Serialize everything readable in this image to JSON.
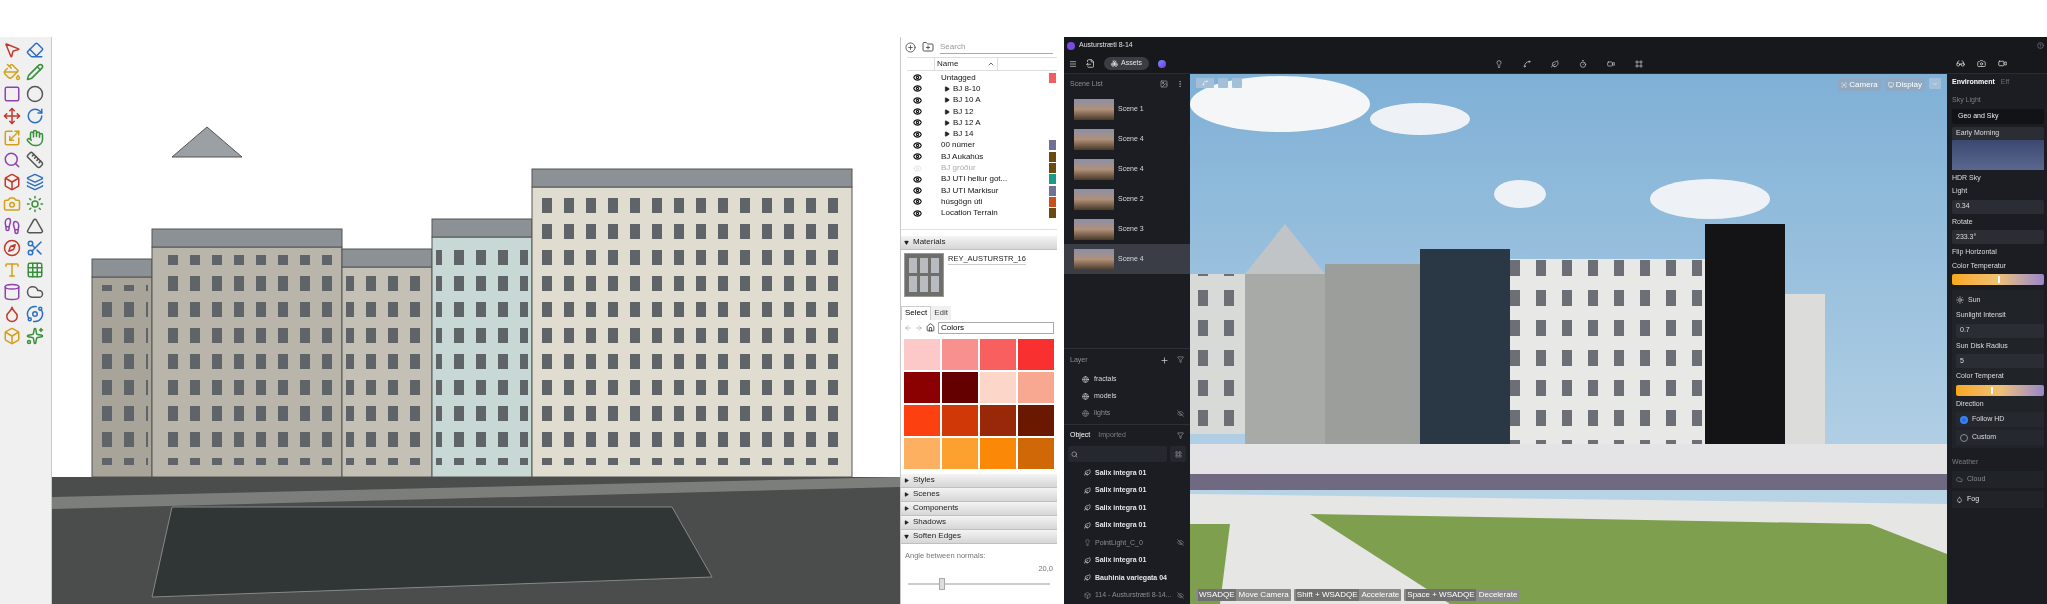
{
  "sketchup": {
    "tags_panel": {
      "search": {
        "placeholder": "Search"
      },
      "column_header": "Name",
      "tags": [
        {
          "name": "Untagged",
          "kind": "tag",
          "visible": true,
          "color": "#f06060"
        },
        {
          "name": "BJ 8-10",
          "kind": "folder",
          "visible": true,
          "expanded": false
        },
        {
          "name": "BJ 10 A",
          "kind": "folder",
          "visible": true,
          "expanded": false
        },
        {
          "name": "BJ 12",
          "kind": "folder",
          "visible": true,
          "expanded": false
        },
        {
          "name": "BJ 12 A",
          "kind": "folder",
          "visible": true,
          "expanded": false
        },
        {
          "name": "BJ 14",
          "kind": "folder",
          "visible": true,
          "expanded": false
        },
        {
          "name": "00 númer",
          "kind": "tag",
          "visible": true,
          "color": "#707094"
        },
        {
          "name": "BJ Aukahús",
          "kind": "tag",
          "visible": true,
          "color": "#6b4a10"
        },
        {
          "name": "BJ gróður",
          "kind": "tag",
          "visible": false,
          "color": "#6b4a10"
        },
        {
          "name": "BJ UTI  hellur got...",
          "kind": "tag",
          "visible": true,
          "color": "#1a9a8a"
        },
        {
          "name": "BJ UTI Markisur",
          "kind": "tag",
          "visible": true,
          "color": "#707094"
        },
        {
          "name": "húsgögn úti",
          "kind": "tag",
          "visible": true,
          "color": "#c8501a"
        },
        {
          "name": "Location Terrain",
          "kind": "tag",
          "visible": true,
          "color": "#6b4a10"
        }
      ]
    },
    "materials": {
      "title": "Materials",
      "expanded": true,
      "material_name": "REY_AUSTURSTR_16",
      "tabs": [
        {
          "label": "Select",
          "selected": true
        },
        {
          "label": "Edit",
          "selected": false
        }
      ],
      "library": "Colors",
      "swatches": [
        {
          "color": "#fcc8c8"
        },
        {
          "color": "#f99090"
        },
        {
          "color": "#f86060"
        },
        {
          "color": "#f83030"
        },
        {
          "color": "#8b0000"
        },
        {
          "color": "#640000"
        },
        {
          "color": "#fcd6c8"
        },
        {
          "color": "#f8a890"
        },
        {
          "color": "#fc4010"
        },
        {
          "color": "#d03808"
        },
        {
          "color": "#982808"
        },
        {
          "color": "#6a1800"
        },
        {
          "color": "#fcb060"
        },
        {
          "color": "#fca030"
        },
        {
          "color": "#fc8808"
        },
        {
          "color": "#d06808"
        }
      ]
    },
    "sections": [
      {
        "title": "Styles",
        "expanded": false
      },
      {
        "title": "Scenes",
        "expanded": false
      },
      {
        "title": "Components",
        "expanded": false
      },
      {
        "title": "Shadows",
        "expanded": false
      },
      {
        "title": "Soften Edges",
        "expanded": true
      }
    ],
    "soften_edges": {
      "label": "Angle between normals:",
      "value": "20,0",
      "level": 0.25
    }
  },
  "app": {
    "title": "Austurstræti 8-14",
    "assets_button": "Assets",
    "scene_list": {
      "title": "Scene List",
      "scenes": [
        {
          "name": "Scene 1",
          "selected": false
        },
        {
          "name": "Scene 4",
          "selected": false
        },
        {
          "name": "Scene 4",
          "selected": false
        },
        {
          "name": "Scene 2",
          "selected": false
        },
        {
          "name": "Scene 3",
          "selected": false
        },
        {
          "name": "Scene 4",
          "selected": true
        }
      ]
    },
    "layers": {
      "title": "Layer",
      "items": [
        {
          "name": "fractals",
          "visible": true
        },
        {
          "name": "models",
          "visible": true
        },
        {
          "name": "lights",
          "visible": false
        }
      ]
    },
    "object_tabs": [
      {
        "label": "Object",
        "selected": true
      },
      {
        "label": "Imported",
        "selected": false
      }
    ],
    "objects": [
      {
        "name": "Salix integra 01",
        "kind": "plant",
        "visible": true
      },
      {
        "name": "Salix integra 01",
        "kind": "plant",
        "visible": true
      },
      {
        "name": "Salix integra 01",
        "kind": "plant",
        "visible": true
      },
      {
        "name": "Salix integra 01",
        "kind": "plant",
        "visible": true
      },
      {
        "name": "PointLight_C_0",
        "kind": "light",
        "visible": false
      },
      {
        "name": "Salix integra 01",
        "kind": "plant",
        "visible": true
      },
      {
        "name": "Bauhinia variegata 04",
        "kind": "plant",
        "visible": true
      },
      {
        "name": "114 - Austurstræti 8-14...",
        "kind": "model",
        "visible": false
      }
    ],
    "viewport": {
      "buttons": [
        "Camera",
        "Display"
      ],
      "hints": [
        {
          "keys": "WSADQE",
          "action": "Move Camera"
        },
        {
          "keys": "Shift + WSADQE",
          "action": "Accelerate"
        },
        {
          "keys": "Space + WSADQE",
          "action": "Decelerate"
        }
      ]
    },
    "inspector": {
      "tabs": [
        {
          "label": "Environment",
          "selected": true
        },
        {
          "label": "Eff",
          "selected": false
        }
      ],
      "sky_light": {
        "title": "Sky Light",
        "mode": "Geo and Sky",
        "preset": "Early Morning",
        "hdr_label": "HDR Sky",
        "light_label": "Light",
        "light_value": "0.34",
        "rotate_label": "Rotate",
        "rotate_value": "233.3°",
        "flip_label": "Flip Horizontal",
        "color_temp": {
          "label": "Color Temperatur",
          "level": 0.5
        }
      },
      "sun": {
        "title": "Sun",
        "intensity_label": "Sunlight Intensit",
        "intensity_value": "0.7",
        "disk_label": "Sun Disk Radius",
        "disk_value": "5",
        "color_temp": {
          "label": "Color Temperat",
          "level": 0.4
        },
        "direction_label": "Direction",
        "direction_options": [
          {
            "label": "Follow HD",
            "selected": true
          },
          {
            "label": "Custom",
            "selected": false
          }
        ]
      },
      "weather": {
        "title": "Weather",
        "items": [
          {
            "label": "Cloud",
            "enabled": false
          },
          {
            "label": "Fog",
            "enabled": true
          }
        ]
      }
    }
  }
}
